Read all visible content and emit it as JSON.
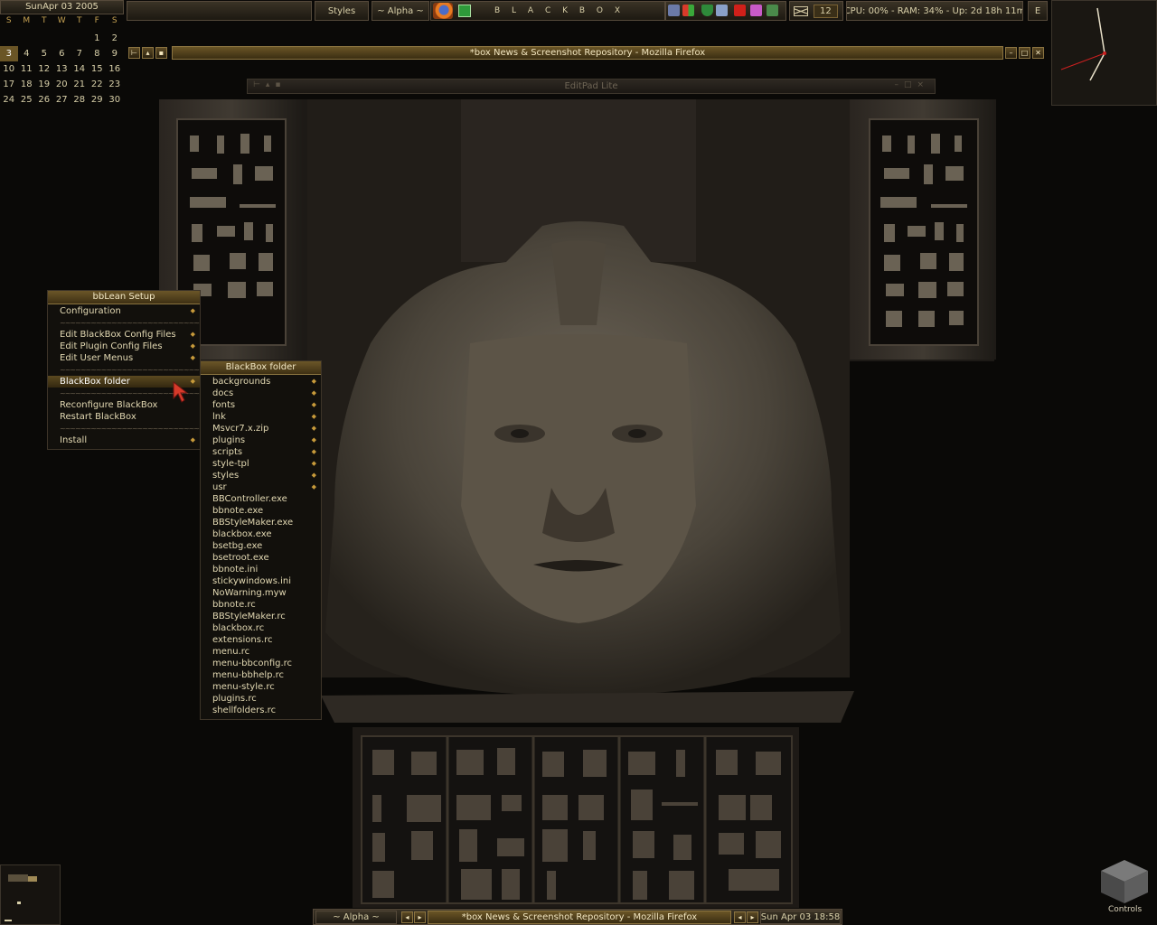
{
  "calendar": {
    "title": "SunApr 03 2005",
    "dow": [
      "S",
      "M",
      "T",
      "W",
      "T",
      "F",
      "S"
    ],
    "weeks": [
      [
        "",
        "",
        "",
        "",
        "",
        "1",
        "2"
      ],
      [
        "3",
        "4",
        "5",
        "6",
        "7",
        "8",
        "9"
      ],
      [
        "10",
        "11",
        "12",
        "13",
        "14",
        "15",
        "16"
      ],
      [
        "17",
        "18",
        "19",
        "20",
        "21",
        "22",
        "23"
      ],
      [
        "24",
        "25",
        "26",
        "27",
        "28",
        "29",
        "30"
      ]
    ],
    "today": "3"
  },
  "toolbar": {
    "styles_label": "Styles",
    "workspace_label": "~ Alpha ~",
    "title": "B L A C K B O X",
    "mail_count": "12",
    "sysinfo": "CPU: 00% - RAM: 34% - Up: 2d 18h 11m",
    "e_label": "E"
  },
  "windows": {
    "firefox_title": "*box News & Screenshot Repository - Mozilla Firefox",
    "editpad_title": "EditPad Lite"
  },
  "setup_menu": {
    "title": "bbLean Setup",
    "items": [
      {
        "label": "Configuration",
        "submenu": true
      },
      {
        "separator": true
      },
      {
        "label": "Edit BlackBox Config Files",
        "submenu": true
      },
      {
        "label": "Edit Plugin Config Files",
        "submenu": true
      },
      {
        "label": "Edit User Menus",
        "submenu": true
      },
      {
        "separator": true
      },
      {
        "label": "BlackBox folder",
        "submenu": true,
        "active": true
      },
      {
        "separator": true
      },
      {
        "label": "Reconfigure BlackBox"
      },
      {
        "label": "Restart BlackBox"
      },
      {
        "separator": true
      },
      {
        "label": "Install",
        "submenu": true
      }
    ]
  },
  "folder_menu": {
    "title": "BlackBox folder",
    "items": [
      {
        "label": "backgrounds",
        "submenu": true
      },
      {
        "label": "docs",
        "submenu": true
      },
      {
        "label": "fonts",
        "submenu": true
      },
      {
        "label": "lnk",
        "submenu": true
      },
      {
        "label": "Msvcr7.x.zip",
        "submenu": true
      },
      {
        "label": "plugins",
        "submenu": true
      },
      {
        "label": "scripts",
        "submenu": true
      },
      {
        "label": "style-tpl",
        "submenu": true
      },
      {
        "label": "styles",
        "submenu": true
      },
      {
        "label": "usr",
        "submenu": true
      },
      {
        "label": "BBController.exe"
      },
      {
        "label": "bbnote.exe"
      },
      {
        "label": "BBStyleMaker.exe"
      },
      {
        "label": "blackbox.exe"
      },
      {
        "label": "bsetbg.exe"
      },
      {
        "label": "bsetroot.exe"
      },
      {
        "label": "bbnote.ini"
      },
      {
        "label": "stickywindows.ini"
      },
      {
        "label": "NoWarning.myw"
      },
      {
        "label": "bbnote.rc"
      },
      {
        "label": "BBStyleMaker.rc"
      },
      {
        "label": "blackbox.rc"
      },
      {
        "label": "extensions.rc"
      },
      {
        "label": "menu.rc"
      },
      {
        "label": "menu-bbconfig.rc"
      },
      {
        "label": "menu-bbhelp.rc"
      },
      {
        "label": "menu-style.rc"
      },
      {
        "label": "plugins.rc"
      },
      {
        "label": "shellfolders.rc"
      }
    ]
  },
  "bottom_bar": {
    "workspace_label": "~ Alpha ~",
    "task_title": "*box News & Screenshot Repository - Mozilla Firefox",
    "datetime": "Sun Apr 03 18:58"
  },
  "desktop": {
    "controls_label": "Controls"
  },
  "icons": {
    "firefox": "firefox-icon",
    "app": "green-app-icon",
    "mail": "mail-icon",
    "clock": "analog-clock"
  },
  "colors": {
    "accent_gold": "#8c7440",
    "menu_bg": "#12100c",
    "text": "#d8cfa8",
    "arrow": "#c79a3a",
    "clock_second": "#cc2020"
  }
}
